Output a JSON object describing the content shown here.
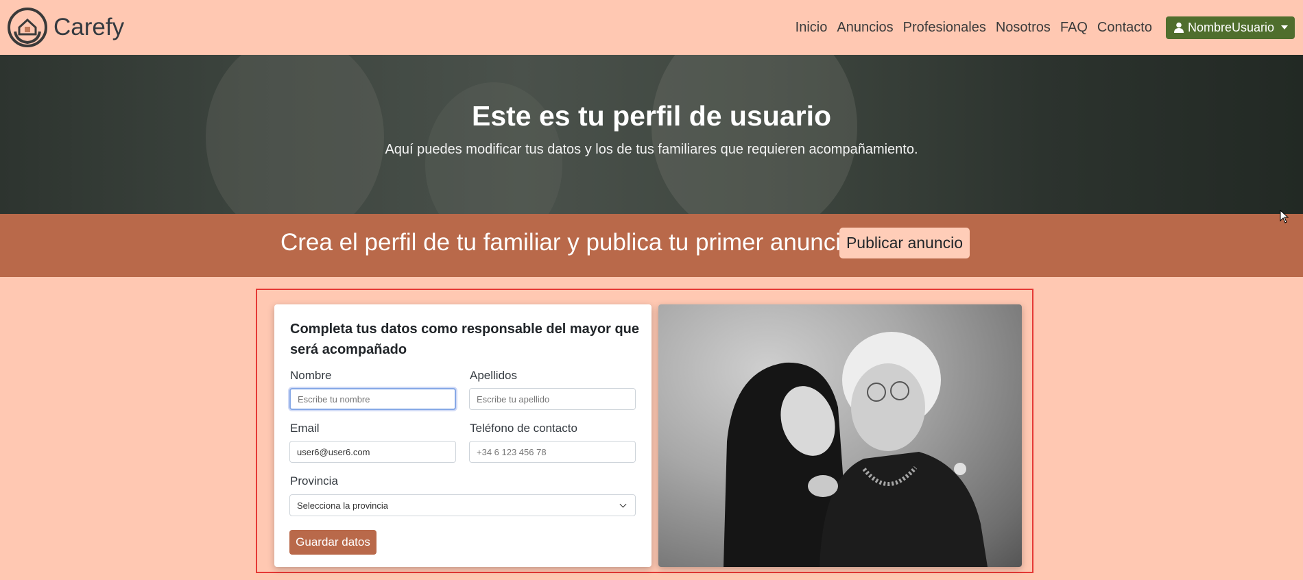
{
  "brand": {
    "name": "Carefy"
  },
  "nav": {
    "items": [
      "Inicio",
      "Anuncios",
      "Profesionales",
      "Nosotros",
      "FAQ",
      "Contacto"
    ],
    "user_label": "NombreUsuario"
  },
  "hero": {
    "title": "Este es tu perfil de usuario",
    "subtitle": "Aquí puedes modificar tus datos y los de tus familiares que requieren acompañamiento."
  },
  "cta": {
    "text": "Crea el perfil de tu familiar y publica tu primer anuncio",
    "button": "Publicar anuncio"
  },
  "form": {
    "title": "Completa tus datos como responsable del mayor que será acompañado",
    "nombre_label": "Nombre",
    "nombre_placeholder": "Escribe tu nombre",
    "apellidos_label": "Apellidos",
    "apellidos_placeholder": "Escribe tu apellido",
    "email_label": "Email",
    "email_value": "user6@user6.com",
    "telefono_label": "Teléfono de contacto",
    "telefono_placeholder": "+34 6 123 456 78",
    "provincia_label": "Provincia",
    "provincia_selected": "Selecciona la provincia",
    "save_button": "Guardar datos"
  },
  "colors": {
    "page_bg": "#ffc8b2",
    "cta_band": "#b9694a",
    "user_button": "#4f6e2d",
    "highlight_border": "#e53935"
  }
}
